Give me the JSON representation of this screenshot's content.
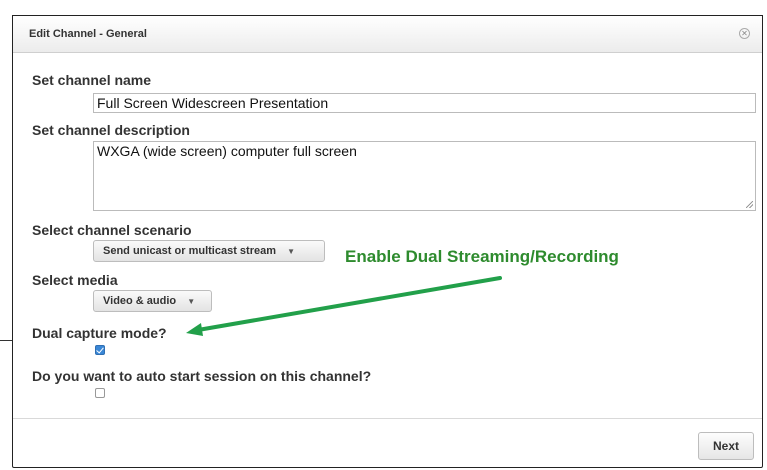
{
  "dialog": {
    "title": "Edit Channel - General",
    "close_icon": "close-icon"
  },
  "form": {
    "name_label": "Set channel name",
    "name_value": "Full Screen Widescreen Presentation",
    "description_label": "Set channel description",
    "description_value": "WXGA (wide screen) computer full screen",
    "scenario_label": "Select channel scenario",
    "scenario_value": "Send unicast or multicast stream",
    "media_label": "Select media",
    "media_value": "Video & audio",
    "dual_capture_label": "Dual capture mode?",
    "dual_capture_checked": true,
    "auto_start_label": "Do you want to auto start session on this channel?",
    "auto_start_checked": false
  },
  "footer": {
    "next_label": "Next"
  },
  "annotation": {
    "text": "Enable Dual Streaming/Recording",
    "color": "#2e8b2e"
  }
}
